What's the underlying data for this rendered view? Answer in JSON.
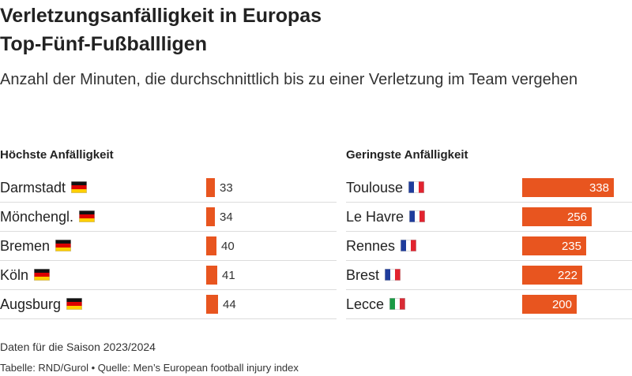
{
  "title_line1": "Verletzungsanfälligkeit in Europas",
  "title_line2": "Top-Fünf-Fußballligen",
  "subtitle": "Anzahl der Minuten, die durchschnittlich bis zu einer Verletzung im Team vergehen",
  "note": "Daten für die Saison 2023/2024",
  "source": "Tabelle: RND/Gurol • Quelle: Men’s European football injury index",
  "colors": {
    "bar": "#e8551f",
    "rule": "#dcdcdc"
  },
  "chart_data": [
    {
      "type": "bar",
      "title": "Höchste Anfälligkeit",
      "categories": [
        "Darmstadt",
        "Mönchengl.",
        "Bremen",
        "Köln",
        "Augsburg"
      ],
      "flags": [
        "germany-flag",
        "germany-flag",
        "germany-flag",
        "germany-flag",
        "germany-flag"
      ],
      "values": [
        33,
        34,
        40,
        41,
        44
      ],
      "xlim": [
        0,
        340
      ]
    },
    {
      "type": "bar",
      "title": "Geringste Anfälligkeit",
      "categories": [
        "Toulouse",
        "Le Havre",
        "Rennes",
        "Brest",
        "Lecce"
      ],
      "flags": [
        "france-flag",
        "france-flag",
        "france-flag",
        "france-flag",
        "italy-flag"
      ],
      "values": [
        338,
        256,
        235,
        222,
        200
      ],
      "xlim": [
        0,
        340
      ]
    }
  ]
}
